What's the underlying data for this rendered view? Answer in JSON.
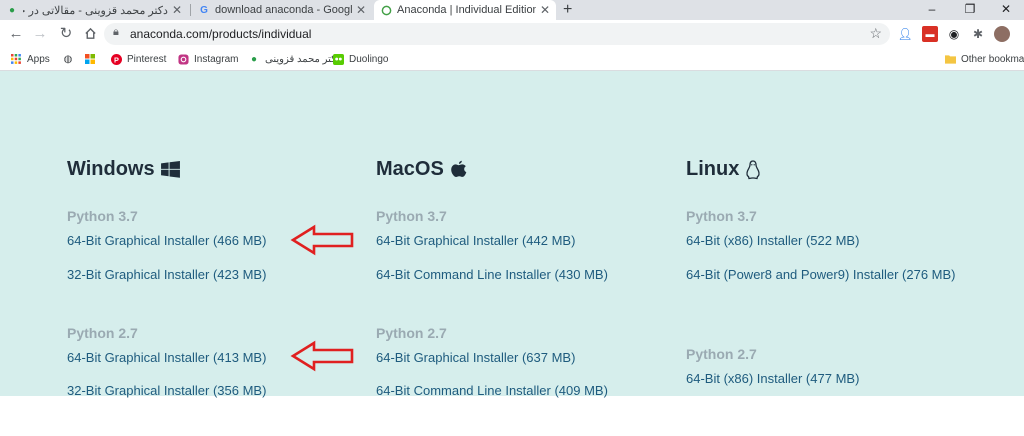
{
  "browser": {
    "tabs": [
      {
        "label": "دکتر محمد قزوینی - مقالاتی در حوزه‌های مد",
        "active": false
      },
      {
        "label": "download anaconda - Google Se",
        "active": false
      },
      {
        "label": "Anaconda | Individual Edition",
        "active": true
      }
    ],
    "new_tab": "+",
    "window_controls": {
      "minimize": "–",
      "restore": "❐",
      "close": "✕"
    },
    "url": "anaconda.com/products/individual",
    "bookmarks": [
      {
        "label": "Apps",
        "icon": "apps-grid-icon"
      },
      {
        "label": "",
        "icon": "globe-icon"
      },
      {
        "label": "",
        "icon": "microsoft-icon"
      },
      {
        "label": "Pinterest",
        "icon": "pinterest-icon"
      },
      {
        "label": "Instagram",
        "icon": "instagram-icon"
      },
      {
        "label": "دکتر محمد قزوینی",
        "icon": "site-icon"
      },
      {
        "label": "Duolingo",
        "icon": "duolingo-icon"
      }
    ],
    "other_bookmarks": "Other bookmar"
  },
  "downloads": {
    "columns": [
      {
        "os": "Windows",
        "icon": "windows-logo-icon",
        "groups": [
          {
            "python": "Python 3.7",
            "links": [
              "64-Bit Graphical Installer (466 MB)",
              "32-Bit Graphical Installer (423 MB)"
            ]
          },
          {
            "python": "Python 2.7",
            "links": [
              "64-Bit Graphical Installer (413 MB)",
              "32-Bit Graphical Installer (356 MB)"
            ]
          }
        ]
      },
      {
        "os": "MacOS",
        "icon": "apple-logo-icon",
        "groups": [
          {
            "python": "Python 3.7",
            "links": [
              "64-Bit Graphical Installer (442 MB)",
              "64-Bit Command Line Installer (430 MB)"
            ]
          },
          {
            "python": "Python 2.7",
            "links": [
              "64-Bit Graphical Installer (637 MB)",
              "64-Bit Command Line Installer (409 MB)"
            ]
          }
        ]
      },
      {
        "os": "Linux",
        "icon": "linux-tux-icon",
        "groups": [
          {
            "python": "Python 3.7",
            "links": [
              "64-Bit (x86) Installer (522 MB)",
              "64-Bit (Power8 and Power9) Installer (276 MB)"
            ]
          },
          {
            "python": "Python 2.7",
            "links": [
              "64-Bit (x86) Installer (477 MB)"
            ]
          }
        ]
      }
    ]
  },
  "colors": {
    "link": "#1e5b7e",
    "background": "#d6eeec",
    "annotation_arrow": "#e02020"
  }
}
